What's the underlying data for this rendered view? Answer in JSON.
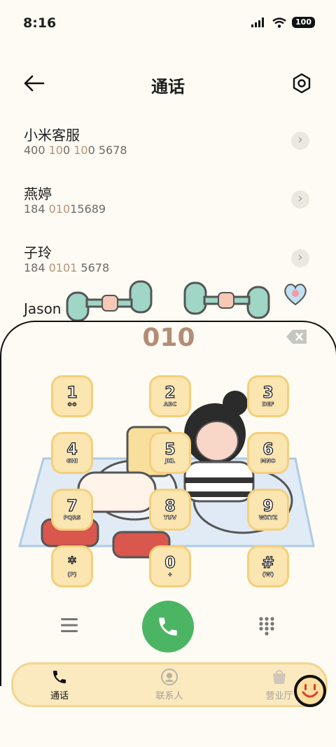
{
  "status": {
    "time": "8:16",
    "battery": "100"
  },
  "header": {
    "title": "通话"
  },
  "contacts": [
    {
      "name": "小米客服",
      "number_parts": [
        "400 ",
        "10",
        "0 ",
        "10",
        "0 5678"
      ]
    },
    {
      "name": "燕婷",
      "number_parts": [
        "184 ",
        "010",
        "15689",
        "",
        ""
      ]
    },
    {
      "name": "子玲",
      "number_parts": [
        "184 ",
        "0101",
        " 5678",
        "",
        ""
      ]
    },
    {
      "name": "Jason",
      "number_parts": [
        "",
        "",
        "",
        "",
        ""
      ]
    }
  ],
  "dialpad": {
    "input": "010",
    "keys": [
      {
        "digit": "1",
        "letters": "⊙⊙"
      },
      {
        "digit": "2",
        "letters": "ABC"
      },
      {
        "digit": "3",
        "letters": "DEF"
      },
      {
        "digit": "4",
        "letters": "GHI"
      },
      {
        "digit": "5",
        "letters": "JKL"
      },
      {
        "digit": "6",
        "letters": "MNO"
      },
      {
        "digit": "7",
        "letters": "PQRS"
      },
      {
        "digit": "8",
        "letters": "TUV"
      },
      {
        "digit": "9",
        "letters": "WXYZ"
      },
      {
        "digit": "*",
        "letters": "(P)"
      },
      {
        "digit": "0",
        "letters": "+"
      },
      {
        "digit": "#",
        "letters": "(W)"
      }
    ]
  },
  "tabs": [
    {
      "label": "通话",
      "icon": "phone-icon",
      "active": true
    },
    {
      "label": "联系人",
      "icon": "contacts-icon",
      "active": false
    },
    {
      "label": "营业厅",
      "icon": "store-icon",
      "active": false
    }
  ],
  "colors": {
    "call_green": "#4cb563",
    "key_fill": "#fbe5b0",
    "highlight": "#b9917a"
  }
}
